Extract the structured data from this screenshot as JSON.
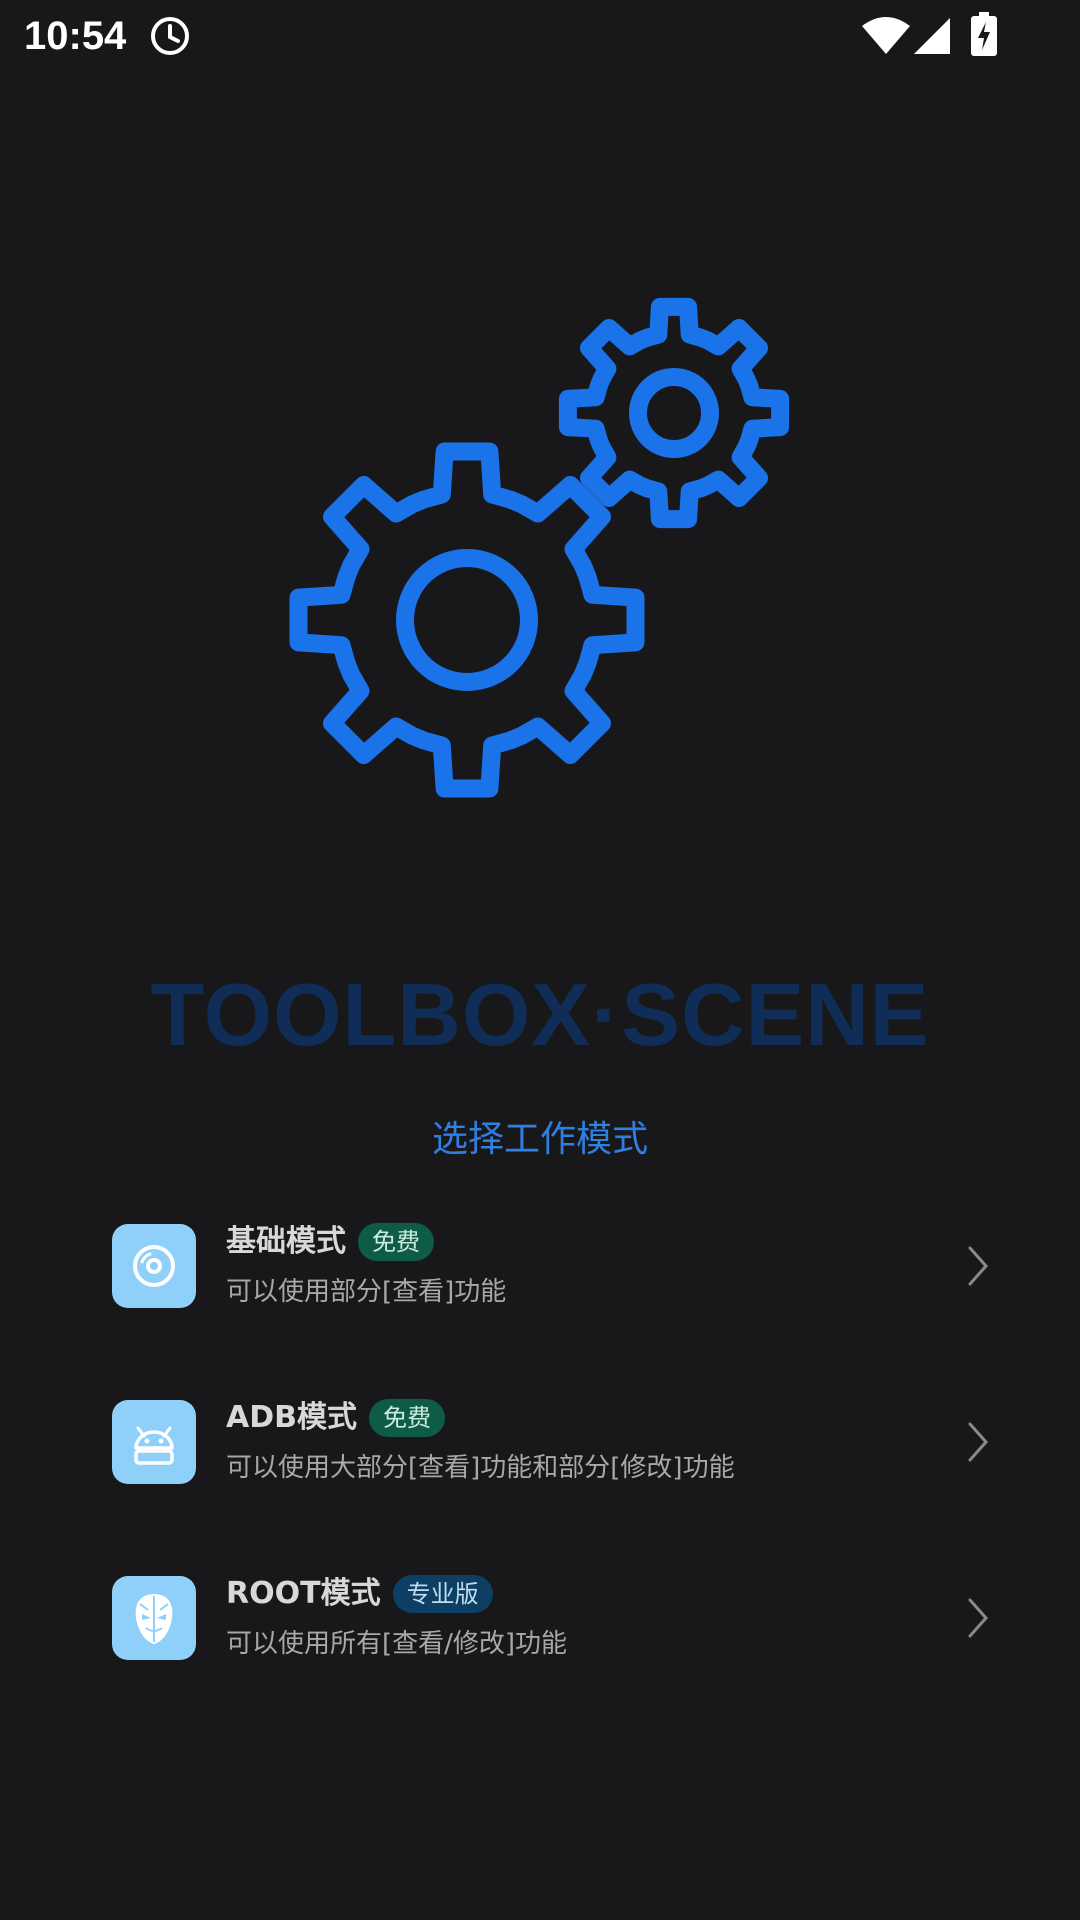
{
  "status_bar": {
    "time": "10:54",
    "icons": [
      "alarm-icon",
      "wifi-icon",
      "signal-icon",
      "battery-charging-icon"
    ]
  },
  "illustration": {
    "icon": "gears-icon",
    "color": "#1a73e8"
  },
  "brand": {
    "title": "TOOLBOX·SCENE",
    "color": "#0f2d57"
  },
  "heading": {
    "text": "选择工作模式",
    "color": "#2f7fe0"
  },
  "modes": [
    {
      "name": "基础模式",
      "badge": "免费",
      "badge_style": "free",
      "description": "可以使用部分[查看]功能",
      "icon": "disc-icon"
    },
    {
      "name": "ADB模式",
      "badge": "免费",
      "badge_style": "free",
      "description": "可以使用大部分[查看]功能和部分[修改]功能",
      "icon": "android-icon"
    },
    {
      "name": "ROOT模式",
      "badge": "专业版",
      "badge_style": "pro",
      "description": "可以使用所有[查看/修改]功能",
      "icon": "mask-icon"
    }
  ],
  "colors": {
    "background": "#18181a",
    "icon_tile": "#8fd0fb",
    "badge_free": "#0f5c46",
    "badge_pro": "#0d3e63"
  }
}
